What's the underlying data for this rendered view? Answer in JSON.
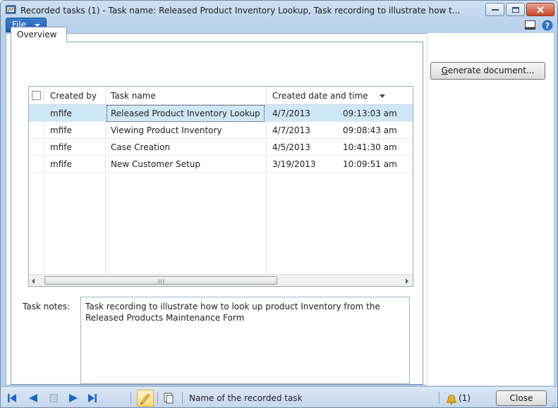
{
  "window": {
    "title": "Recorded tasks (1) - Task name: Released Product Inventory Lookup, Task recording to illustrate how t..."
  },
  "menu": {
    "file_label": "File"
  },
  "tabs": [
    {
      "label": "Overview"
    }
  ],
  "buttons": {
    "generate_document": "Generate document...",
    "close": "Close"
  },
  "grid": {
    "columns": [
      "Created by",
      "Task name",
      "Created date and time"
    ],
    "rows": [
      {
        "created_by": "mfife",
        "task_name": "Released Product Inventory Lookup",
        "date": "4/7/2013",
        "time": "09:13:03 am"
      },
      {
        "created_by": "mfife",
        "task_name": "Viewing Product Inventory",
        "date": "4/7/2013",
        "time": "09:08:43 am"
      },
      {
        "created_by": "mfife",
        "task_name": "Case Creation",
        "date": "4/5/2013",
        "time": "10:41:30 am"
      },
      {
        "created_by": "mfife",
        "task_name": "New Customer Setup",
        "date": "3/19/2013",
        "time": "10:09:51 am"
      }
    ],
    "selected_row": 0,
    "scroll_grip": "III"
  },
  "task_notes": {
    "label": "Task notes:",
    "value": "Task recording to illustrate how to look up product Inventory from the Released Products Maintenance Form"
  },
  "status": {
    "text": "Name of the recorded task",
    "notification_count": "(1)"
  },
  "icons": {
    "app": "recorder-app-icon",
    "minimize": "minimize-icon",
    "maximize": "maximize-icon",
    "close": "close-icon",
    "panes": "panes-icon",
    "help": "help-icon",
    "first": "first-record-icon",
    "previous": "previous-record-icon",
    "list": "list-icon",
    "next": "next-record-icon",
    "last": "last-record-icon",
    "edit": "pencil-icon",
    "copy": "copy-icon",
    "notification": "bell-icon"
  },
  "colors": {
    "accent": "#1f5fb6",
    "selection": "#cfe8f8",
    "window_frame": "#b9d1ea",
    "nav_arrows": "#1b66c9",
    "close_caption": "#c8452a"
  }
}
